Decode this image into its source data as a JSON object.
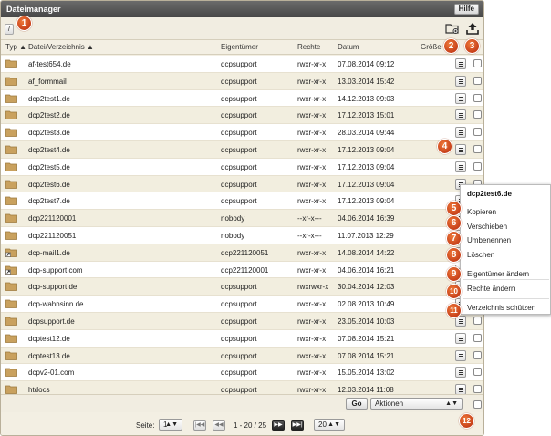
{
  "window": {
    "title": "Dateimanager",
    "help_label": "Hilfe"
  },
  "toolbar": {
    "path": "/",
    "new_folder_icon": "new-folder-icon",
    "upload_icon": "upload-icon"
  },
  "columns": {
    "type": "Typ ▲",
    "name": "Datei/Verzeichnis ▲",
    "owner": "Eigentümer",
    "rights": "Rechte",
    "date": "Datum",
    "size": "Größe"
  },
  "rows": [
    {
      "icon": "folder",
      "name": "af-test654.de",
      "owner": "dcpsupport",
      "rights": "rwxr-xr-x",
      "date": "07.08.2014 09:12"
    },
    {
      "icon": "folder",
      "name": "af_formmail",
      "owner": "dcpsupport",
      "rights": "rwxr-xr-x",
      "date": "13.03.2014 15:42"
    },
    {
      "icon": "folder",
      "name": "dcp2test1.de",
      "owner": "dcpsupport",
      "rights": "rwxr-xr-x",
      "date": "14.12.2013 09:03"
    },
    {
      "icon": "folder",
      "name": "dcp2test2.de",
      "owner": "dcpsupport",
      "rights": "rwxr-xr-x",
      "date": "17.12.2013 15:01"
    },
    {
      "icon": "folder",
      "name": "dcp2test3.de",
      "owner": "dcpsupport",
      "rights": "rwxr-xr-x",
      "date": "28.03.2014 09:44"
    },
    {
      "icon": "folder",
      "name": "dcp2test4.de",
      "owner": "dcpsupport",
      "rights": "rwxr-xr-x",
      "date": "17.12.2013 09:04"
    },
    {
      "icon": "folder",
      "name": "dcp2test5.de",
      "owner": "dcpsupport",
      "rights": "rwxr-xr-x",
      "date": "17.12.2013 09:04"
    },
    {
      "icon": "folder",
      "name": "dcp2test6.de",
      "owner": "dcpsupport",
      "rights": "rwxr-xr-x",
      "date": "17.12.2013 09:04"
    },
    {
      "icon": "folder",
      "name": "dcp2test7.de",
      "owner": "dcpsupport",
      "rights": "rwxr-xr-x",
      "date": "17.12.2013 09:04"
    },
    {
      "icon": "folder",
      "name": "dcp221120001",
      "owner": "nobody",
      "rights": "--xr-x---",
      "date": "04.06.2014 16:39"
    },
    {
      "icon": "folder",
      "name": "dcp221120051",
      "owner": "nobody",
      "rights": "--xr-x---",
      "date": "11.07.2013 12:29"
    },
    {
      "icon": "link-folder",
      "name": "dcp-mail1.de",
      "owner": "dcp221120051",
      "rights": "rwxr-xr-x",
      "date": "14.08.2014 14:22"
    },
    {
      "icon": "link-folder",
      "name": "dcp-support.com",
      "owner": "dcp221120001",
      "rights": "rwxr-xr-x",
      "date": "04.06.2014 16:21"
    },
    {
      "icon": "folder",
      "name": "dcp-support.de",
      "owner": "dcpsupport",
      "rights": "rwxrwxr-x",
      "date": "30.04.2014 12:03"
    },
    {
      "icon": "folder",
      "name": "dcp-wahnsinn.de",
      "owner": "dcpsupport",
      "rights": "rwxr-xr-x",
      "date": "02.08.2013 10:49"
    },
    {
      "icon": "folder",
      "name": "dcpsupport.de",
      "owner": "dcpsupport",
      "rights": "rwxr-xr-x",
      "date": "23.05.2014 10:03"
    },
    {
      "icon": "folder",
      "name": "dcptest12.de",
      "owner": "dcpsupport",
      "rights": "rwxr-xr-x",
      "date": "07.08.2014 15:21"
    },
    {
      "icon": "folder",
      "name": "dcptest13.de",
      "owner": "dcpsupport",
      "rights": "rwxr-xr-x",
      "date": "07.08.2014 15:21"
    },
    {
      "icon": "folder",
      "name": "dcpv2-01.com",
      "owner": "dcpsupport",
      "rights": "rwxr-xr-x",
      "date": "15.05.2014 13:02"
    },
    {
      "icon": "folder",
      "name": "htdocs",
      "owner": "dcpsupport",
      "rights": "rwxr-xr-x",
      "date": "12.03.2014 11:08"
    }
  ],
  "actions": {
    "go_label": "Go",
    "select_value": "Aktionen"
  },
  "pager": {
    "page_label": "Seite:",
    "page_value": "1",
    "range_text": "1 - 20 / 25",
    "per_page": "20",
    "first_icon": "first-page-icon",
    "prev_icon": "prev-page-icon",
    "next_icon": "next-page-icon",
    "last_icon": "last-page-icon"
  },
  "context_menu": {
    "title": "dcp2test6.de",
    "items": [
      "Kopieren",
      "Verschieben",
      "Umbenennen",
      "Löschen",
      "Eigentümer ändern",
      "Rechte ändern",
      "Verzeichnis schützen"
    ]
  },
  "badges": [
    "1",
    "2",
    "3",
    "4",
    "5",
    "6",
    "7",
    "8",
    "9",
    "10",
    "11",
    "12"
  ],
  "colors": {
    "badge": "#d24a1e",
    "titlebar": "#555555",
    "folder": "#c9a15e"
  }
}
